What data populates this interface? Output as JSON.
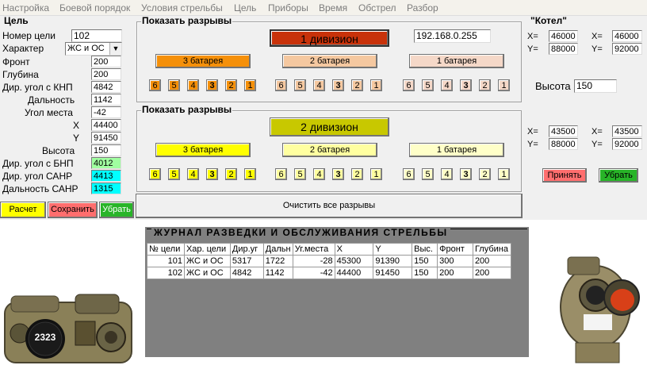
{
  "menu": [
    "Настройка",
    "Боевой порядок",
    "Условия стрельбы",
    "Цель",
    "Приборы",
    "Время",
    "Обстрел",
    "Разбор"
  ],
  "target": {
    "group_title": "Цель",
    "fields": [
      {
        "label": "Номер цели",
        "value": "102"
      },
      {
        "label": "Характер",
        "value": "ЖС и ОС"
      },
      {
        "label": "Фронт",
        "value": "200"
      },
      {
        "label": "Глубина",
        "value": "200"
      },
      {
        "label": "Дир. угол с КНП",
        "value": "4842"
      },
      {
        "label": "Дальность",
        "value": "1142"
      },
      {
        "label": "Угол места",
        "value": "-42"
      },
      {
        "label": "X",
        "value": "44400"
      },
      {
        "label": "Y",
        "value": "91450"
      },
      {
        "label": "Высота",
        "value": "150"
      },
      {
        "label": "Дир. угол с БНП",
        "value": "4012"
      },
      {
        "label": "Дир. угол САНР",
        "value": "4413"
      },
      {
        "label": "Дальность САНР",
        "value": "1315"
      }
    ],
    "buttons": {
      "calc": "Расчет",
      "save": "Сохранить",
      "remove": "Убрать"
    }
  },
  "division1": {
    "group_title": "Показать разрывы",
    "title": "1 дивизион",
    "ip": "192.168.0.255",
    "batteries": [
      "3 батарея",
      "2 батарея",
      "1 батарея"
    ],
    "shots": [
      "6",
      "5",
      "4",
      "3",
      "2",
      "1"
    ]
  },
  "division2": {
    "group_title": "Показать разрывы",
    "title": "2 дивизион",
    "batteries": [
      "3 батарея",
      "2 батарея",
      "1 батарея"
    ],
    "shots": [
      "6",
      "5",
      "4",
      "3",
      "2",
      "1"
    ]
  },
  "clear_button": "Очистить все разрывы",
  "kotel": {
    "title": "\"Котел\"",
    "top": {
      "x_label": "X=",
      "y_label": "Y=",
      "x1": "46000",
      "y1": "88000",
      "x2": "46000",
      "y2": "92000"
    },
    "height_label": "Высота",
    "height_value": "150",
    "bottom": {
      "x_label": "X=",
      "y_label": "Y=",
      "x1": "43500",
      "y1": "88000",
      "x2": "43500",
      "y2": "92000"
    },
    "accept": "Принять",
    "remove": "Убрать"
  },
  "journal": {
    "title": "ЖУРНАЛ РАЗВЕДКИ И ОБСЛУЖИВАНИЯ СТРЕЛЬБЫ",
    "columns": [
      "№ цели",
      "Хар. цели",
      "Дир.уг",
      "Дальн",
      "Уг.места",
      "X",
      "Y",
      "Выс.",
      "Фронт",
      "Глубина"
    ],
    "rows": [
      [
        "101",
        "ЖС и ОС",
        "5317",
        "1722",
        "-28",
        "45300",
        "91390",
        "150",
        "300",
        "200"
      ],
      [
        "102",
        "ЖС и ОС",
        "4842",
        "1142",
        "-42",
        "44400",
        "91450",
        "150",
        "200",
        "200"
      ]
    ]
  },
  "device_counter": "2323",
  "colors": {
    "div1_title": "#c8320a",
    "div1_battery": "#f5900a",
    "div1_battery_mid": "#f5c8a0",
    "div1_battery_right": "#f5d8c8",
    "div2_title": "#c8c800",
    "div2_battery": "#ffff00",
    "div2_battery_mid": "#ffffa0",
    "div2_battery_right": "#ffffc8",
    "calc": "#ffff00",
    "save": "#ff6e6e",
    "remove": "#28b428",
    "journal_bg": "#808080"
  }
}
